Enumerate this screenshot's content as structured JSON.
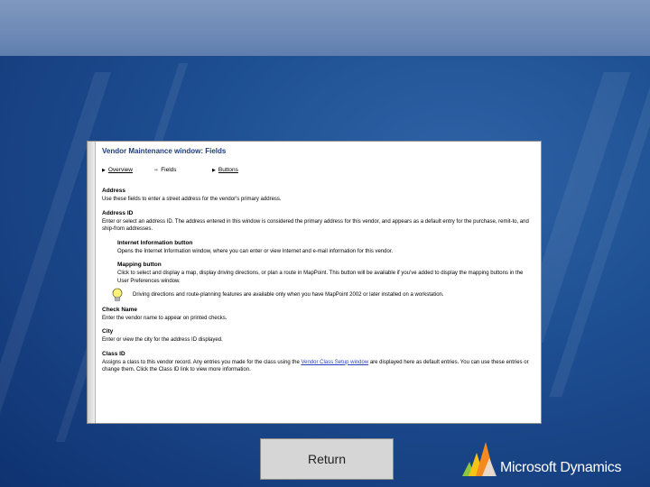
{
  "help": {
    "title": "Vendor Maintenance window: Fields",
    "nav": {
      "overview": "Overview",
      "fields": "Fields",
      "buttons": "Buttons"
    },
    "address_label": "Address",
    "address_desc": "Use these fields to enter a street address for the vendor's primary address.",
    "address_id_label": "Address ID",
    "address_id_desc": "Enter or select an address ID. The address entered in this window is considered the primary address for this vendor, and appears as a default entry for the purchase, remit-to, and ship-from addresses.",
    "internet_label": "Internet Information button",
    "internet_desc": "Opens the Internet Information window, where you can enter or view Internet and e-mail information for this vendor.",
    "mapping_label": "Mapping button",
    "mapping_desc": "Click to select and display a map, display driving directions, or plan a route in MapPoint. This button will be available if you've added to display the mapping buttons in the User Preferences window.",
    "note_text": "Driving directions and route-planning features are available only when you have MapPoint 2002 or later installed on a workstation.",
    "check_name_label": "Check Name",
    "check_name_desc": "Enter the vendor name to appear on printed checks.",
    "city_label": "City",
    "city_desc": "Enter or view the city for the address ID displayed.",
    "class_id_label": "Class ID",
    "class_id_desc_1": "Assigns a class to this vendor record. Any entries you made for the class using the ",
    "class_id_link": "Vendor Class Setup window",
    "class_id_desc_2": " are displayed here as default entries. You can use these entries or change them. Click the Class ID link to view more information."
  },
  "return_label": "Return",
  "logo_text": "Microsoft Dynamics",
  "colors": {
    "background": "#1e4f93",
    "topbar": "#6e8ab6",
    "title": "#1f3d79",
    "button": "#d6d6d6",
    "link": "#2a40c0"
  }
}
